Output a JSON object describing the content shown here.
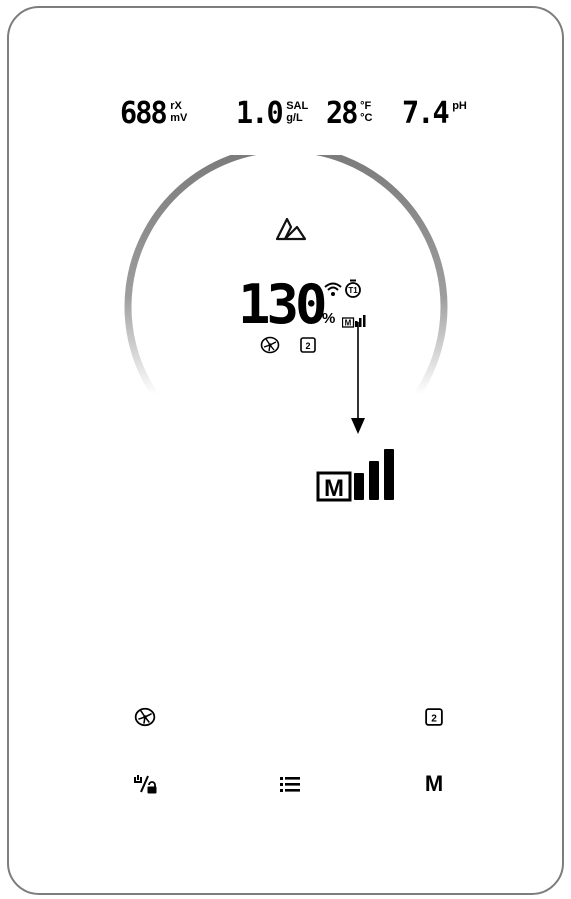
{
  "readings": {
    "orp": {
      "value": "688",
      "unit_top": "rX",
      "unit_bottom": "mV"
    },
    "salt": {
      "value": "1.0",
      "unit_top": "SAL",
      "unit_bottom": "g/L"
    },
    "temp": {
      "value": "28",
      "unit_top": "°F",
      "unit_bottom": "°C"
    },
    "ph": {
      "value": "7.4",
      "unit_top": "pH"
    }
  },
  "main": {
    "production_value": "130",
    "production_unit": "%",
    "timer_label": "T1",
    "small_mode_letter": "M",
    "program_number": "2"
  },
  "zoom": {
    "mode_letter": "M"
  },
  "buttons": {
    "program_number": "2",
    "mode_label": "M"
  },
  "icons": [
    "brand-logo-icon",
    "wifi-icon",
    "timer-t1-icon",
    "signal-icon",
    "fan-icon",
    "program-2-icon",
    "arrow-down-icon",
    "power-lock-icon",
    "menu-list-icon"
  ]
}
